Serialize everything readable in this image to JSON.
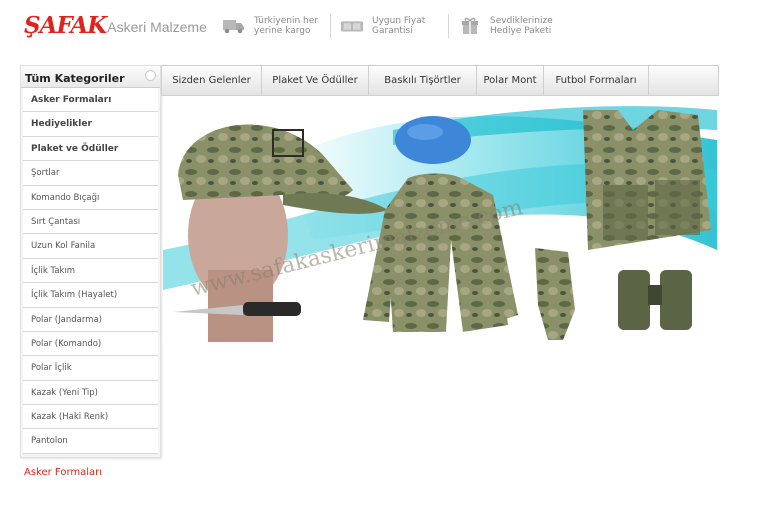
{
  "header": {
    "logo_brand": "ŞAFAK",
    "logo_sub": "Askeri Malzeme",
    "features": [
      {
        "icon": "truck-icon",
        "text": "Türkiyenin her yerine kargo"
      },
      {
        "icon": "price-tag-icon",
        "text": "Uygun Fiyat Garantisi"
      },
      {
        "icon": "gift-icon",
        "text": "Sevdiklerinize Hediye Paketi"
      }
    ]
  },
  "sidebar": {
    "title": "Tüm Kategoriler",
    "items": [
      {
        "label": "Asker Formaları",
        "bold": true
      },
      {
        "label": "Hediyelikler",
        "bold": true
      },
      {
        "label": "Plaket ve Ödüller",
        "bold": true
      },
      {
        "label": "Şortlar",
        "bold": false
      },
      {
        "label": "Komando Bıçağı",
        "bold": false
      },
      {
        "label": "Sırt Çantası",
        "bold": false
      },
      {
        "label": "Uzun Kol Fanila",
        "bold": false
      },
      {
        "label": "İçlik Takım",
        "bold": false
      },
      {
        "label": "İçlik Takım (Hayalet)",
        "bold": false
      },
      {
        "label": "Polar (Jandarma)",
        "bold": false
      },
      {
        "label": "Polar (Komando)",
        "bold": false
      },
      {
        "label": "Polar İçlik",
        "bold": false
      },
      {
        "label": "Kazak (Yeni Tip)",
        "bold": false
      },
      {
        "label": "Kazak (Haki Renk)",
        "bold": false
      },
      {
        "label": "Pantolon",
        "bold": false
      }
    ]
  },
  "navbar": {
    "items": [
      "Sizden Gelenler",
      "Plaket Ve Ödüller",
      "Baskılı Tişörtler",
      "Polar Mont",
      "Futbol Formaları"
    ]
  },
  "banner": {
    "watermark": "www.safakaskerimalzeme.com"
  },
  "footer": {
    "link": "Asker Formaları"
  },
  "colors": {
    "brand_red": "#e1231d",
    "banner_cyan": "#14c3d3",
    "camo": "#6f7a55",
    "beret_blue": "#3d86d8"
  }
}
